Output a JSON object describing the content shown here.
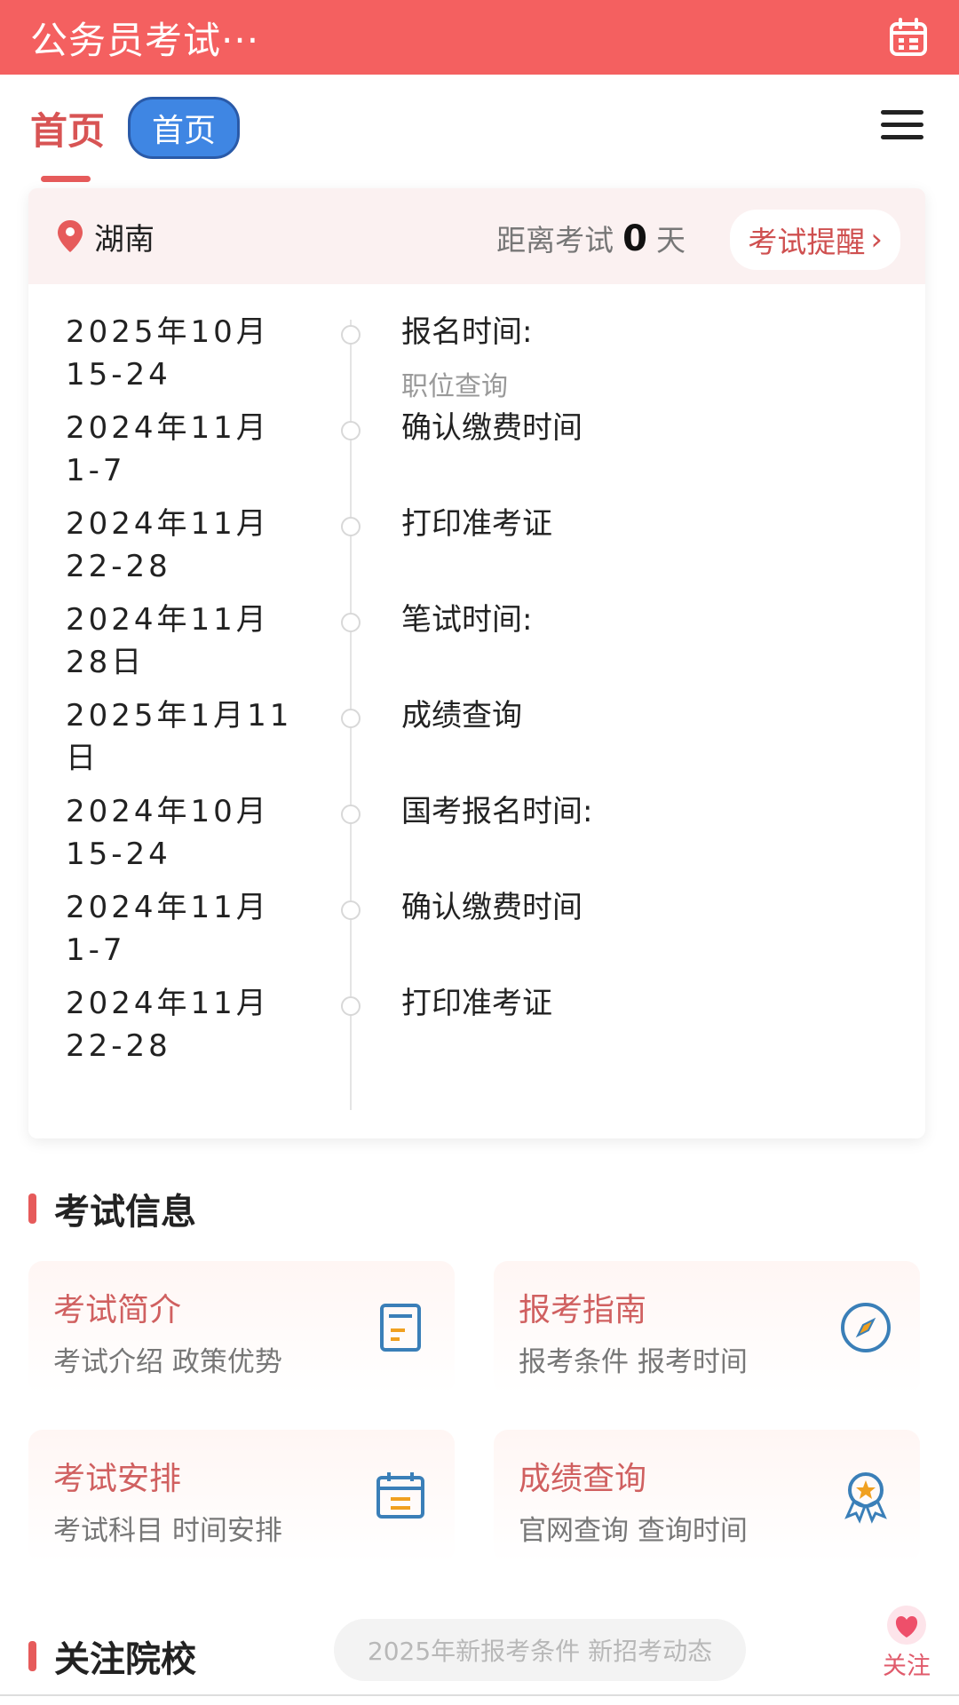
{
  "app": {
    "title": "公务员考试···"
  },
  "tabs": {
    "active": "首页",
    "pill": "首页"
  },
  "card": {
    "location": "湖南",
    "countdown_prefix": "距离考试",
    "countdown_value": "0",
    "countdown_unit": "天",
    "remind_label": "考试提醒"
  },
  "timeline": [
    {
      "date_line1": "2025年10月",
      "date_line2": "15-24",
      "label": "报名时间:",
      "sub": "职位查询"
    },
    {
      "date_line1": "2024年11月",
      "date_line2": "1-7",
      "label": "确认缴费时间",
      "sub": ""
    },
    {
      "date_line1": "2024年11月",
      "date_line2": "22-28",
      "label": "打印准考证",
      "sub": ""
    },
    {
      "date_line1": "2024年11月",
      "date_line2": "28日",
      "label": "笔试时间:",
      "sub": ""
    },
    {
      "date_line1": "2025年1月11",
      "date_line2": "日",
      "label": "成绩查询",
      "sub": ""
    },
    {
      "date_line1": "2024年10月",
      "date_line2": "15-24",
      "label": "国考报名时间:",
      "sub": ""
    },
    {
      "date_line1": "2024年11月",
      "date_line2": "1-7",
      "label": "确认缴费时间",
      "sub": ""
    },
    {
      "date_line1": "2024年11月",
      "date_line2": "22-28",
      "label": "打印准考证",
      "sub": ""
    }
  ],
  "exam_info": {
    "section_title": "考试信息",
    "items": [
      {
        "title": "考试简介",
        "subtitle": "考试介绍 政策优势",
        "icon": "document-icon"
      },
      {
        "title": "报考指南",
        "subtitle": "报考条件 报考时间",
        "icon": "compass-icon"
      },
      {
        "title": "考试安排",
        "subtitle": "考试科目 时间安排",
        "icon": "calendar-icon"
      },
      {
        "title": "成绩查询",
        "subtitle": "官网查询 查询时间",
        "icon": "award-icon"
      }
    ]
  },
  "follow_section": {
    "title": "关注院校",
    "search_placeholder": "2025年新报考条件 新招考动态",
    "follow_label": "关注"
  },
  "colors": {
    "topbar": "#f46060",
    "accent": "#d85454",
    "pill": "#3f86e3",
    "icon_blue": "#3a7fb8",
    "icon_orange": "#f0a020"
  }
}
